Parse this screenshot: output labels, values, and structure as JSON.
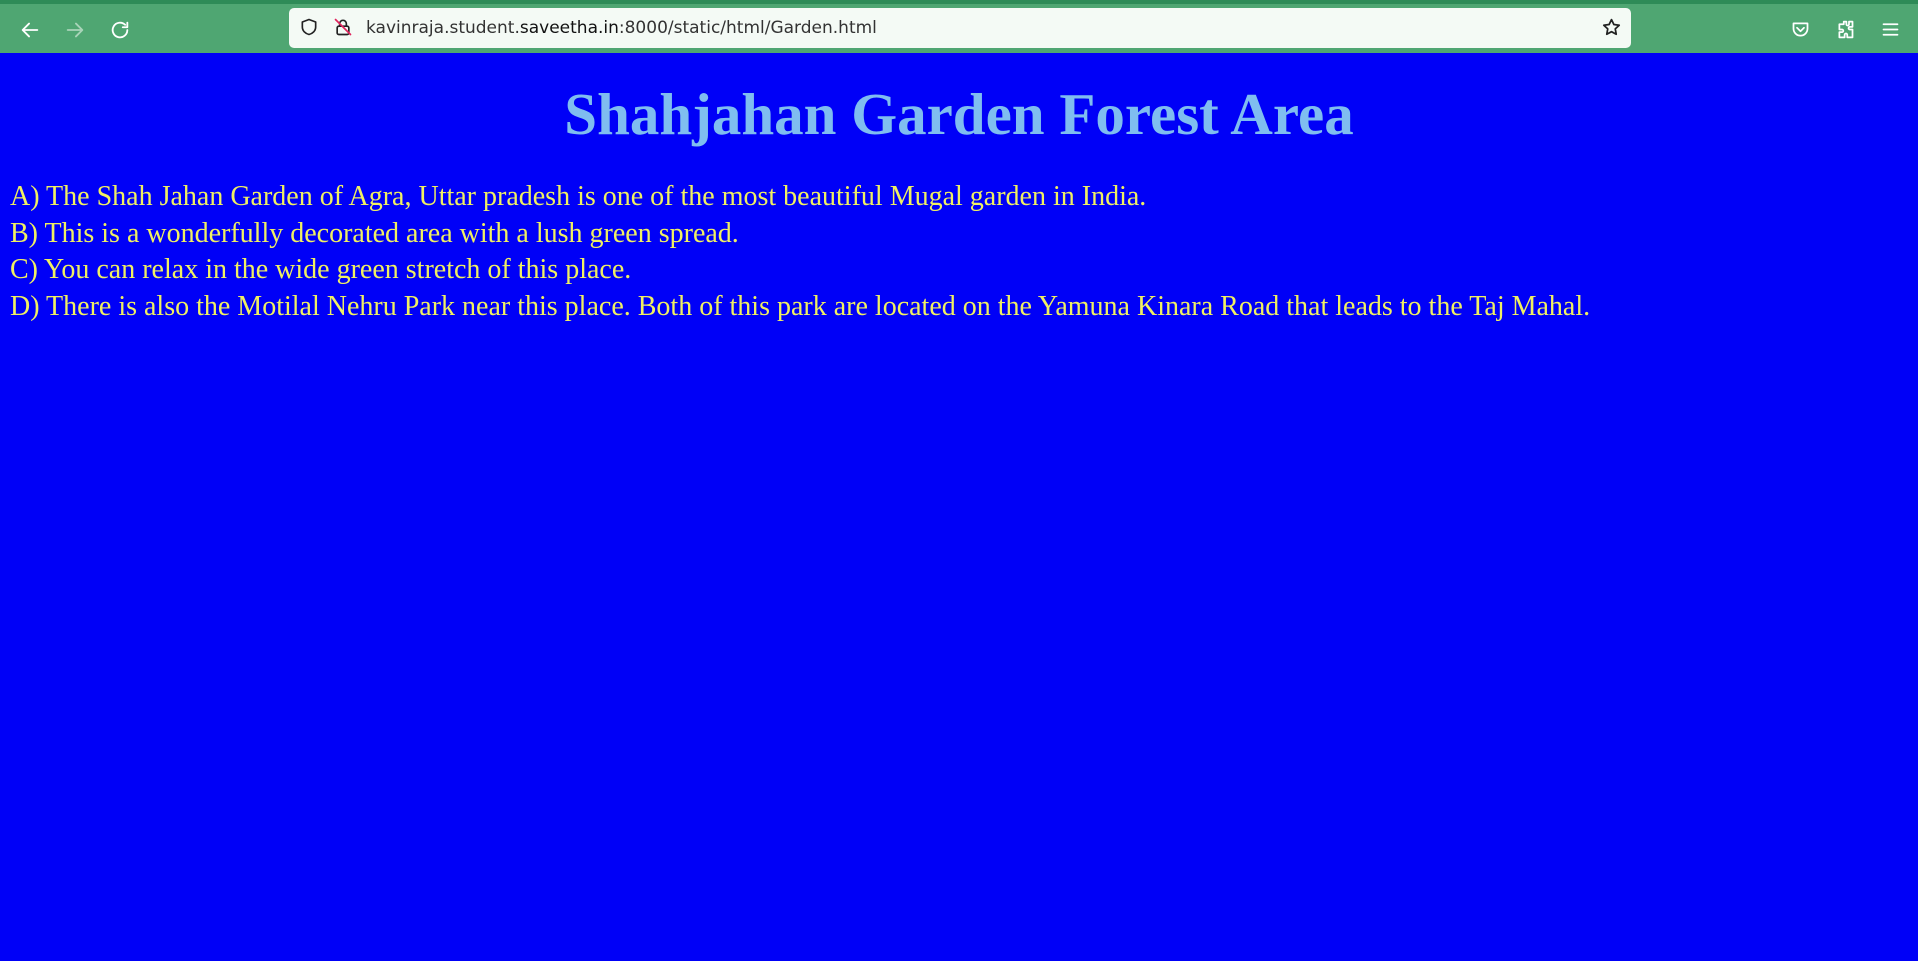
{
  "browser": {
    "url_prefix": "kavinraja.student.",
    "url_host": "saveetha.in",
    "url_suffix": ":8000/static/html/Garden.html",
    "icons": {
      "back": "arrow-left-icon",
      "forward": "arrow-right-icon",
      "reload": "reload-icon",
      "shield": "shield-icon",
      "insecure": "insecure-lock-icon",
      "bookmark": "star-icon",
      "pocket": "pocket-icon",
      "extensions": "puzzle-icon",
      "menu": "hamburger-menu-icon"
    },
    "toolbar_color": "#4fa672"
  },
  "page": {
    "title": "Shahjahan Garden Forest Area",
    "background": "#0000f7",
    "title_color": "#7fbdf0",
    "text_color": "#f0f062",
    "lines": [
      "A) The Shah Jahan Garden of Agra, Uttar pradesh is one of the most beautiful Mugal garden in India.",
      "B) This is a wonderfully decorated area with a lush green spread.",
      "C) You can relax in the wide green stretch of this place.",
      "D) There is also the Motilal Nehru Park near this place. Both of this park are located on the Yamuna Kinara Road that leads to the Taj Mahal."
    ]
  }
}
